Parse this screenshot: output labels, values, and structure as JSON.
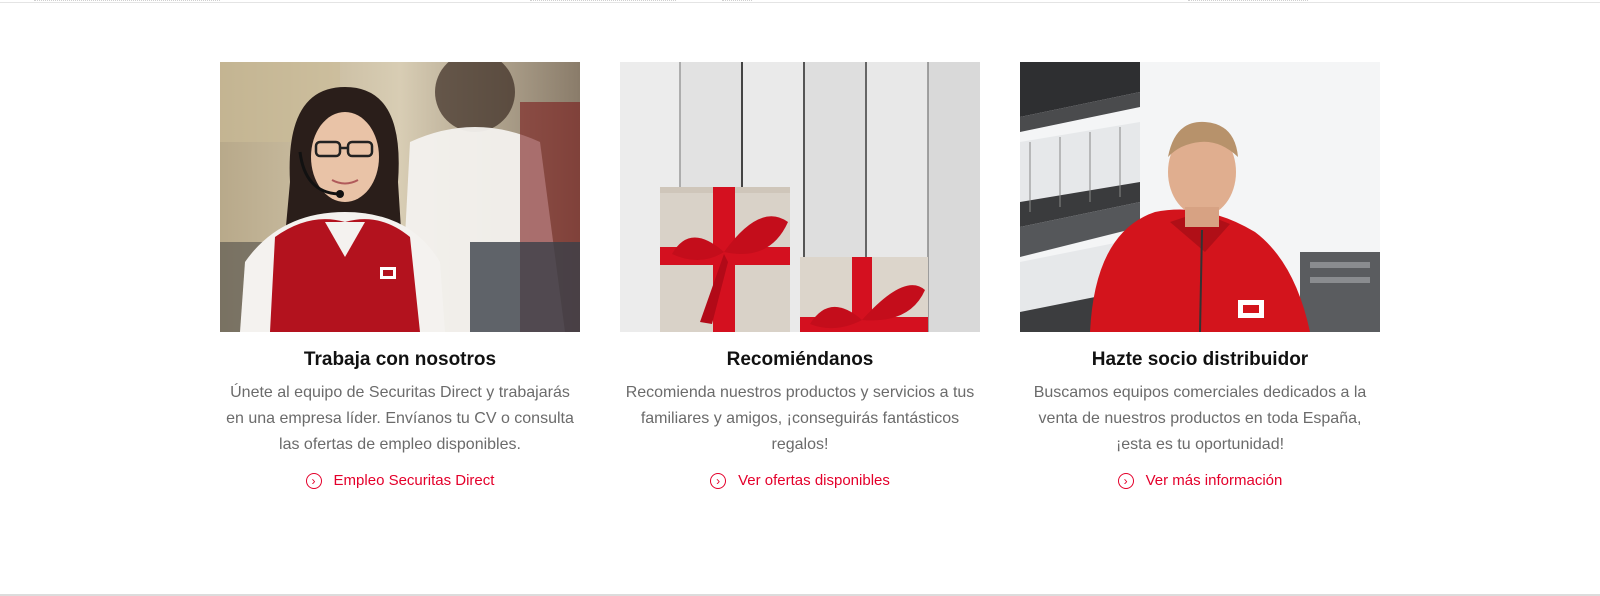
{
  "cards": [
    {
      "title": "Trabaja con nosotros",
      "text": "Únete al equipo de Securitas Direct y trabajarás en una empresa líder. Envíanos tu CV o consulta las ofertas de empleo disponibles.",
      "link": "Empleo Securitas Direct",
      "image": "operator-headset-photo"
    },
    {
      "title": "Recomiéndanos",
      "text": "Recomienda nuestros productos y servicios a tus familiares y amigos, ¡conseguirás fantásticos regalos!",
      "link": "Ver ofertas disponibles",
      "image": "gift-boxes-photo"
    },
    {
      "title": "Hazte socio distribuidor",
      "text": "Buscamos equipos comerciales dedicados a la venta de nuestros productos en toda España, ¡esta es tu oportunidad!",
      "link": "Ver más información",
      "image": "red-jacket-man-photo"
    }
  ],
  "colors": {
    "accent": "#e4002b",
    "body_text": "#6b6b6b",
    "title": "#111111"
  },
  "icons": {
    "link_icon": "chevron-circle-right-icon"
  }
}
